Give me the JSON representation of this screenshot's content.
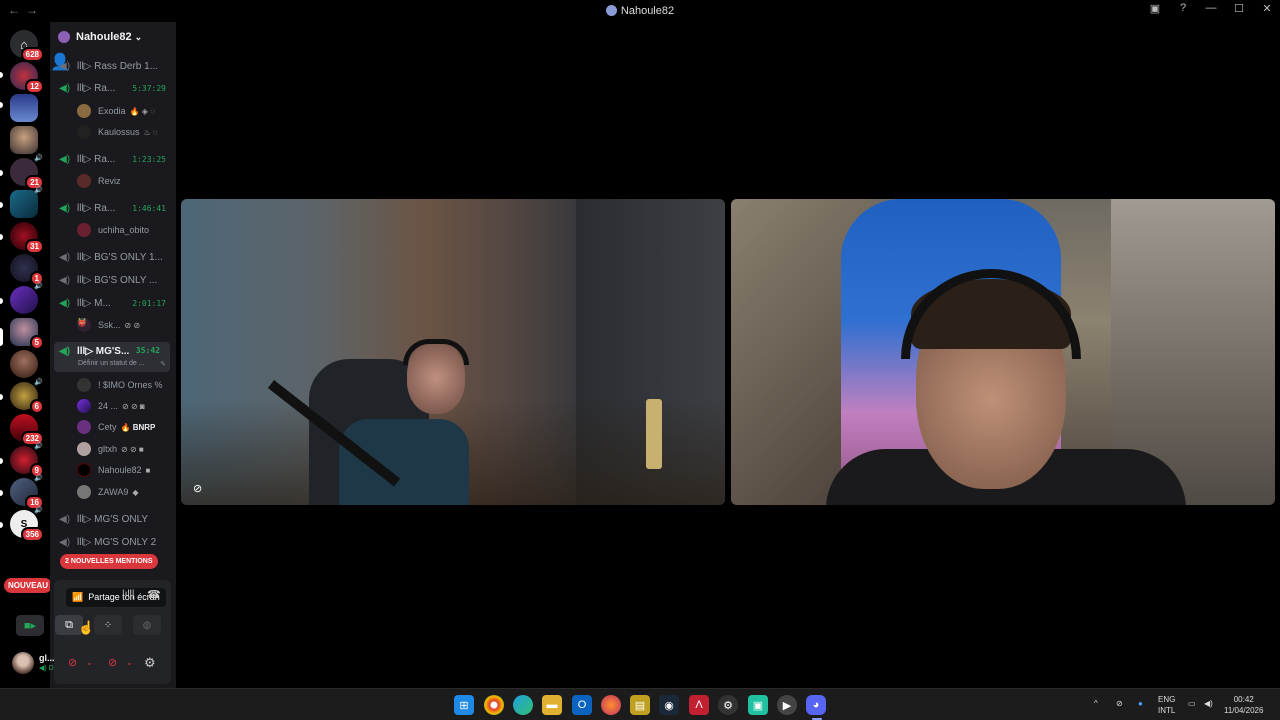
{
  "window": {
    "title": "Nahoule82",
    "nav_back": "←",
    "nav_forward": "→"
  },
  "guild_rail": {
    "badges": [
      "628",
      "12",
      "21",
      "31",
      "1",
      "5",
      "6",
      "232",
      "9",
      "16",
      "356"
    ],
    "nouveau_label": "NOUVEAU"
  },
  "server": {
    "name": "Nahoule82"
  },
  "channels": [
    {
      "name": "lll▷ Rass Derb 1...",
      "timer": ""
    },
    {
      "name": "lll▷ Ra...",
      "timer": "5:37:29"
    },
    {
      "name": "lll▷ Ra...",
      "timer": "1:23:25"
    },
    {
      "name": "lll▷ Ra...",
      "timer": "1:46:41"
    },
    {
      "name": "lll▷ BG'S ONLY 1...",
      "timer": ""
    },
    {
      "name": "lll▷ BG'S ONLY ...",
      "timer": ""
    },
    {
      "name": "lll▷ M...",
      "timer": "2:01:17"
    },
    {
      "name": "lll▷ MG'S...",
      "timer": "35:42",
      "sub": "Définir un statut de ..."
    },
    {
      "name": "lll▷ MG'S ONLY",
      "timer": ""
    },
    {
      "name": "lll▷ MG'S ONLY 2",
      "timer": ""
    }
  ],
  "members": [
    {
      "name": "Exodia",
      "tag": ""
    },
    {
      "name": "Kaulossus",
      "tag": ""
    },
    {
      "name": "Reviz",
      "tag": ""
    },
    {
      "name": "uchiha_obito",
      "tag": ""
    },
    {
      "name": "Ssk...",
      "tag": ""
    },
    {
      "name": "! $IMO Ornes %",
      "tag": ""
    },
    {
      "name": "24 ...",
      "tag": ""
    },
    {
      "name": "Cety",
      "tag": "BNRP"
    },
    {
      "name": "gltxh",
      "tag": ""
    },
    {
      "name": "Nahoule82",
      "tag": ""
    },
    {
      "name": "ZAWA9",
      "tag": ""
    }
  ],
  "mentions_label": "2 NOUVELLES MENTIONS",
  "voice_panel": {
    "tooltip": "Partage ton écran"
  },
  "me": {
    "name": "gl...",
    "status": "D"
  },
  "taskbar": {
    "lang_top": "ENG",
    "lang_bottom": "INTL",
    "time": "00:42",
    "date": "11/04/2026"
  },
  "colors": {
    "accent_green": "#23a55a",
    "danger_red": "#da373c",
    "sidebar_bg": "#1a1a1e"
  }
}
